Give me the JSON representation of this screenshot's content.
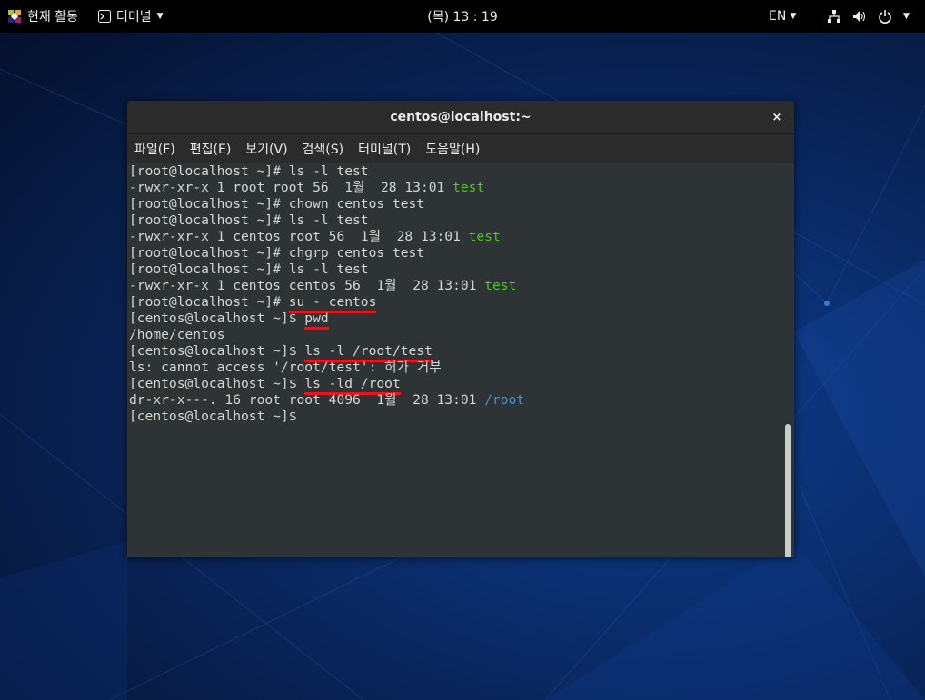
{
  "topbar": {
    "activities": "현재 활동",
    "app_menu": "터미널",
    "clock": "(목) 13 : 19",
    "lang": "EN"
  },
  "window": {
    "title": "centos@localhost:~",
    "close": "×",
    "menu": [
      "파일(F)",
      "편집(E)",
      "보기(V)",
      "검색(S)",
      "터미널(T)",
      "도움말(H)"
    ]
  },
  "terminal": {
    "lines": [
      {
        "segments": [
          {
            "text": "[root@localhost ~]# ls -l test"
          }
        ]
      },
      {
        "segments": [
          {
            "text": "-rwxr-xr-x 1 root root 56  1월  28 13:01 "
          },
          {
            "text": "test",
            "color": "green"
          }
        ]
      },
      {
        "segments": [
          {
            "text": "[root@localhost ~]# chown centos test"
          }
        ]
      },
      {
        "segments": [
          {
            "text": "[root@localhost ~]# ls -l test"
          }
        ]
      },
      {
        "segments": [
          {
            "text": "-rwxr-xr-x 1 centos root 56  1월  28 13:01 "
          },
          {
            "text": "test",
            "color": "green"
          }
        ]
      },
      {
        "segments": [
          {
            "text": "[root@localhost ~]# chgrp centos test"
          }
        ]
      },
      {
        "segments": [
          {
            "text": "[root@localhost ~]# ls -l test"
          }
        ]
      },
      {
        "segments": [
          {
            "text": "-rwxr-xr-x 1 centos centos 56  1월  28 13:01 "
          },
          {
            "text": "test",
            "color": "green"
          }
        ]
      },
      {
        "segments": [
          {
            "text": "[root@localhost ~]# "
          },
          {
            "text": "su - centos",
            "underline": true
          }
        ]
      },
      {
        "segments": [
          {
            "text": "[centos@localhost ~]$ "
          },
          {
            "text": "pwd",
            "underline": true
          }
        ]
      },
      {
        "segments": [
          {
            "text": "/home/centos"
          }
        ]
      },
      {
        "segments": [
          {
            "text": "[centos@localhost ~]$ "
          },
          {
            "text": "ls -l /root/test",
            "underline": true
          }
        ]
      },
      {
        "segments": [
          {
            "text": "ls: cannot access '/root/test': 허가 거부"
          }
        ]
      },
      {
        "segments": [
          {
            "text": "[centos@localhost ~]$ "
          },
          {
            "text": "ls -ld /root",
            "underline": true
          }
        ]
      },
      {
        "segments": [
          {
            "text": "dr-xr-x---. 16 root root 4096  1월  28 13:01 "
          },
          {
            "text": "/root",
            "color": "blue"
          }
        ]
      },
      {
        "segments": [
          {
            "text": "[centos@localhost ~]$ "
          }
        ]
      }
    ]
  },
  "colors": {
    "terminal_bg": "#2e3436",
    "terminal_fg": "#d3d7cf",
    "green": "#4ec90f",
    "blue": "#3f8fe0",
    "underline": "#e8141e"
  }
}
